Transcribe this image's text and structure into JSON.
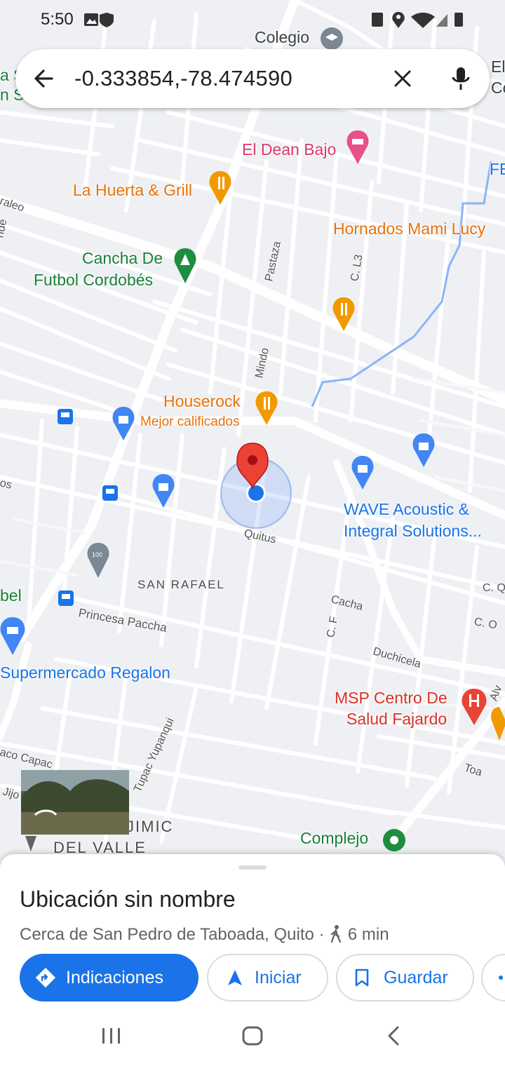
{
  "status_bar": {
    "time": "5:50"
  },
  "search": {
    "query": "-0.333854,-78.474590"
  },
  "map": {
    "pois": [
      {
        "name": "Colegio",
        "color": "#3c4043"
      },
      {
        "name": "El Dean Bajo",
        "color": "#d93965"
      },
      {
        "name": "La Huerta & Grill",
        "color": "#e8710a"
      },
      {
        "name": "Hornados Mami Lucy",
        "color": "#e8710a"
      },
      {
        "name": "Cancha De",
        "color": "#188038"
      },
      {
        "name": "Futbol Cordobés",
        "color": "#188038"
      },
      {
        "name": "Houserock",
        "color": "#e8710a"
      },
      {
        "name": "Mejor calificados",
        "color": "#e8710a"
      },
      {
        "name": "WAVE Acoustic &",
        "color": "#1a73e8"
      },
      {
        "name": "Integral Solutions...",
        "color": "#1a73e8"
      },
      {
        "name": "Supermercado Regalon",
        "color": "#1a73e8"
      },
      {
        "name": "MSP Centro De",
        "color": "#d93025"
      },
      {
        "name": "Salud Fajardo",
        "color": "#d93025"
      },
      {
        "name": "Complejo",
        "color": "#188038"
      },
      {
        "name": "bel",
        "color": "#188038"
      },
      {
        "name": "FE",
        "color": "#1a73e8"
      },
      {
        "name": "a S",
        "color": "#188038"
      },
      {
        "name": "n Sa",
        "color": "#188038"
      },
      {
        "name": "El",
        "color": "#3c4043"
      },
      {
        "name": "Co",
        "color": "#3c4043"
      }
    ],
    "streets": [
      "raleo",
      "Pastaza",
      "C. L3",
      "Mindo",
      "Quitus",
      "Cacha",
      "C. F",
      "Duchicela",
      "C. Q",
      "C. O",
      "Princesa Paccha",
      "Tupac Yupanqui",
      "Toa",
      "aco Capac",
      "Jijo",
      "nde",
      "os",
      "Alv"
    ],
    "areas": [
      "SAN RAFAEL",
      "JIMIC",
      "DEL VALLE"
    ],
    "bus_stop_label": "100"
  },
  "place": {
    "title": "Ubicación sin nombre",
    "subtitle": "Cerca de San Pedro de Taboada, Quito",
    "walk_time": "6 min"
  },
  "actions": {
    "directions": "Indicaciones",
    "start": "Iniciar",
    "save": "Guardar"
  },
  "colors": {
    "accent": "#1a73e8",
    "pin": "#ea4335"
  }
}
